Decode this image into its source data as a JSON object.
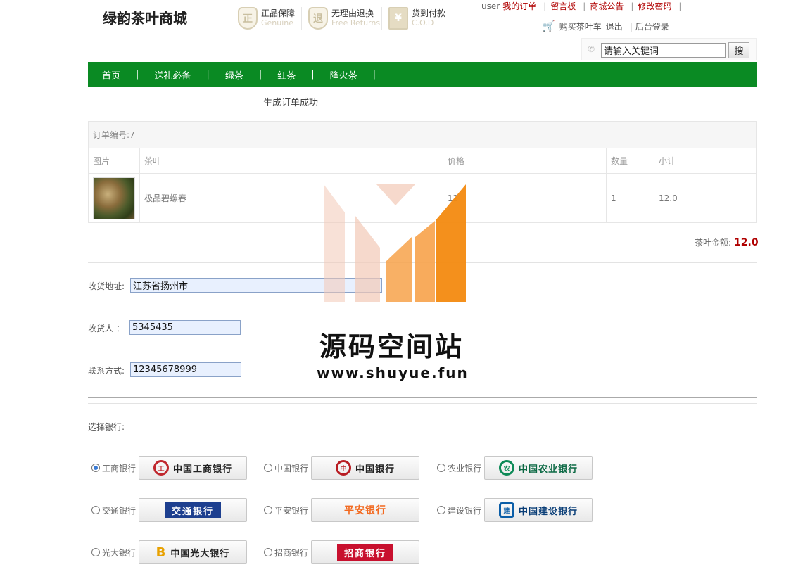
{
  "header": {
    "logo": "绿韵茶叶商城",
    "badges": [
      {
        "icon": "genuine-shield-icon",
        "glyph": "正",
        "title": "正品保障",
        "subtitle": "Genuine"
      },
      {
        "icon": "return-shield-icon",
        "glyph": "退",
        "title": "无理由退换",
        "subtitle": "Free Returns"
      },
      {
        "icon": "cod-box-icon",
        "glyph": "¥",
        "title": "货到付款",
        "subtitle": "C.O.D"
      }
    ],
    "user": "user",
    "links": [
      "我的订单",
      "留言板",
      "商城公告",
      "修改密码"
    ],
    "cart": "购买茶叶车",
    "logout": "退出",
    "admin": "后台登录",
    "search_placeholder": "请输入关键词",
    "search_button": "搜"
  },
  "nav": [
    "首页",
    "送礼必备",
    "绿茶",
    "红茶",
    "降火茶"
  ],
  "nav_separator": "|",
  "order": {
    "success_message": "生成订单成功",
    "order_number": "订单编号:7",
    "columns": [
      "图片",
      "茶叶",
      "价格",
      "数量",
      "小计"
    ],
    "items": [
      {
        "name": "极品碧螺春",
        "price": "12",
        "quantity": "1",
        "subtotal": "12.0"
      }
    ],
    "total_label": "茶叶金额:",
    "total_value": "12.0"
  },
  "form": {
    "address_label": "收货地址:",
    "address_value": "江苏省扬州市",
    "receiver_label": "收货人 ：",
    "receiver_value": "5345435",
    "phone_label": "联系方式:",
    "phone_value": "12345678999"
  },
  "bank_section": {
    "label": "选择银行:",
    "banks": [
      {
        "name": "工商银行",
        "logo_text": "中国工商银行",
        "color": "#c0272d",
        "selected": true
      },
      {
        "name": "中国银行",
        "logo_text": "中国银行",
        "color": "#b81c22",
        "selected": false
      },
      {
        "name": "农业银行",
        "logo_text": "中国农业银行",
        "color": "#0d8a57",
        "selected": false
      },
      {
        "name": "交通银行",
        "logo_text": "交通银行",
        "color": "#1d3f8f",
        "selected": false
      },
      {
        "name": "平安银行",
        "logo_text": "平安银行",
        "color": "#f26a21",
        "selected": false
      },
      {
        "name": "建设银行",
        "logo_text": "中国建设银行",
        "color": "#0b5ea8",
        "selected": false
      },
      {
        "name": "光大银行",
        "logo_text": "中国光大银行",
        "color": "#e8a100",
        "selected": false
      },
      {
        "name": "招商银行",
        "logo_text": "招商银行",
        "color": "#c8102e",
        "selected": false
      }
    ]
  },
  "watermark": {
    "title": "源码空间站",
    "url": "www.shuyue.fun",
    "colors": [
      "#f2c9b6",
      "#f7a24a",
      "#f38a10"
    ]
  }
}
